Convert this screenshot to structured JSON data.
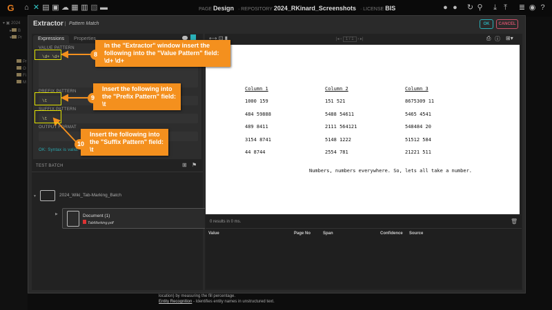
{
  "topbar": {
    "page_label": "PAGE",
    "page": "Design",
    "repo_label": "REPOSITORY",
    "repo": "2024_RKinard_Screenshots",
    "license_label": "LICENSE",
    "license": "BIS"
  },
  "tree": {
    "items": [
      "2024",
      "B",
      "Pr",
      "",
      "",
      "Pr",
      "O",
      "Fi",
      "M"
    ]
  },
  "dialog": {
    "title": "Extractor",
    "subtitle": "Pattern Match",
    "ok": "OK",
    "cancel": "CANCEL",
    "tabs": [
      "Expressions",
      "Properties"
    ],
    "value_pattern_label": "VALUE PATTERN",
    "value_pattern": "\\d+ \\d+",
    "prefix_pattern_label": "PREFIX PATTERN",
    "prefix_pattern": "\\t",
    "suffix_pattern_label": "SUFFIX PATTERN",
    "suffix_pattern": "\\t",
    "output_format_label": "OUTPUT FORMAT",
    "output_format": "",
    "syntax_status": "OK: Syntax is valid.",
    "test_batch_label": "TEST BATCH",
    "batch_name": "2024_Wiki_Tab-Marking_Batch",
    "document_name": "Document (1)",
    "file_name": "TabMarking.pdf",
    "pager": "1 / 1",
    "document": {
      "columns": [
        "Column 1",
        "Column 2",
        "Column 3"
      ],
      "rows": [
        [
          "1000 159",
          "151 521",
          "8675309 11"
        ],
        [
          "484 59888",
          "5488 54611",
          "5465 4541"
        ],
        [
          "489 8411",
          "2111 564121",
          "548484 20"
        ],
        [
          "3154 8741",
          "5148 1222",
          "51512 584"
        ],
        [
          "44 8744",
          "2554 781",
          "21221 511"
        ]
      ],
      "footer": "Numbers, numbers everywhere. So, lets all take a number."
    },
    "results_status": "0 results in 0 ms.",
    "result_columns": [
      "Value",
      "Page No",
      "Span",
      "Confidence",
      "Source"
    ]
  },
  "background_text": [
    "location) by measuring the fill percentage.",
    "Entity Recognition",
    " - Identifies entity names in unstructured text."
  ],
  "callouts": [
    {
      "number": "8",
      "text": "In the \"Extractor\" window insert the following into the \"Value Pattern\" field:",
      "value": "\\d+ \\d+"
    },
    {
      "number": "9",
      "text": "Insert the following into the \"Prefix Pattern\" field:",
      "value": "\\t"
    },
    {
      "number": "10",
      "text": "Insert the following into the \"Suffix Pattern\" field:",
      "value": "\\t"
    }
  ],
  "colors": {
    "callout": "#f4901e",
    "highlight": "#e5e500",
    "ok": "#2ab0b8",
    "cancel": "#d0506a"
  }
}
